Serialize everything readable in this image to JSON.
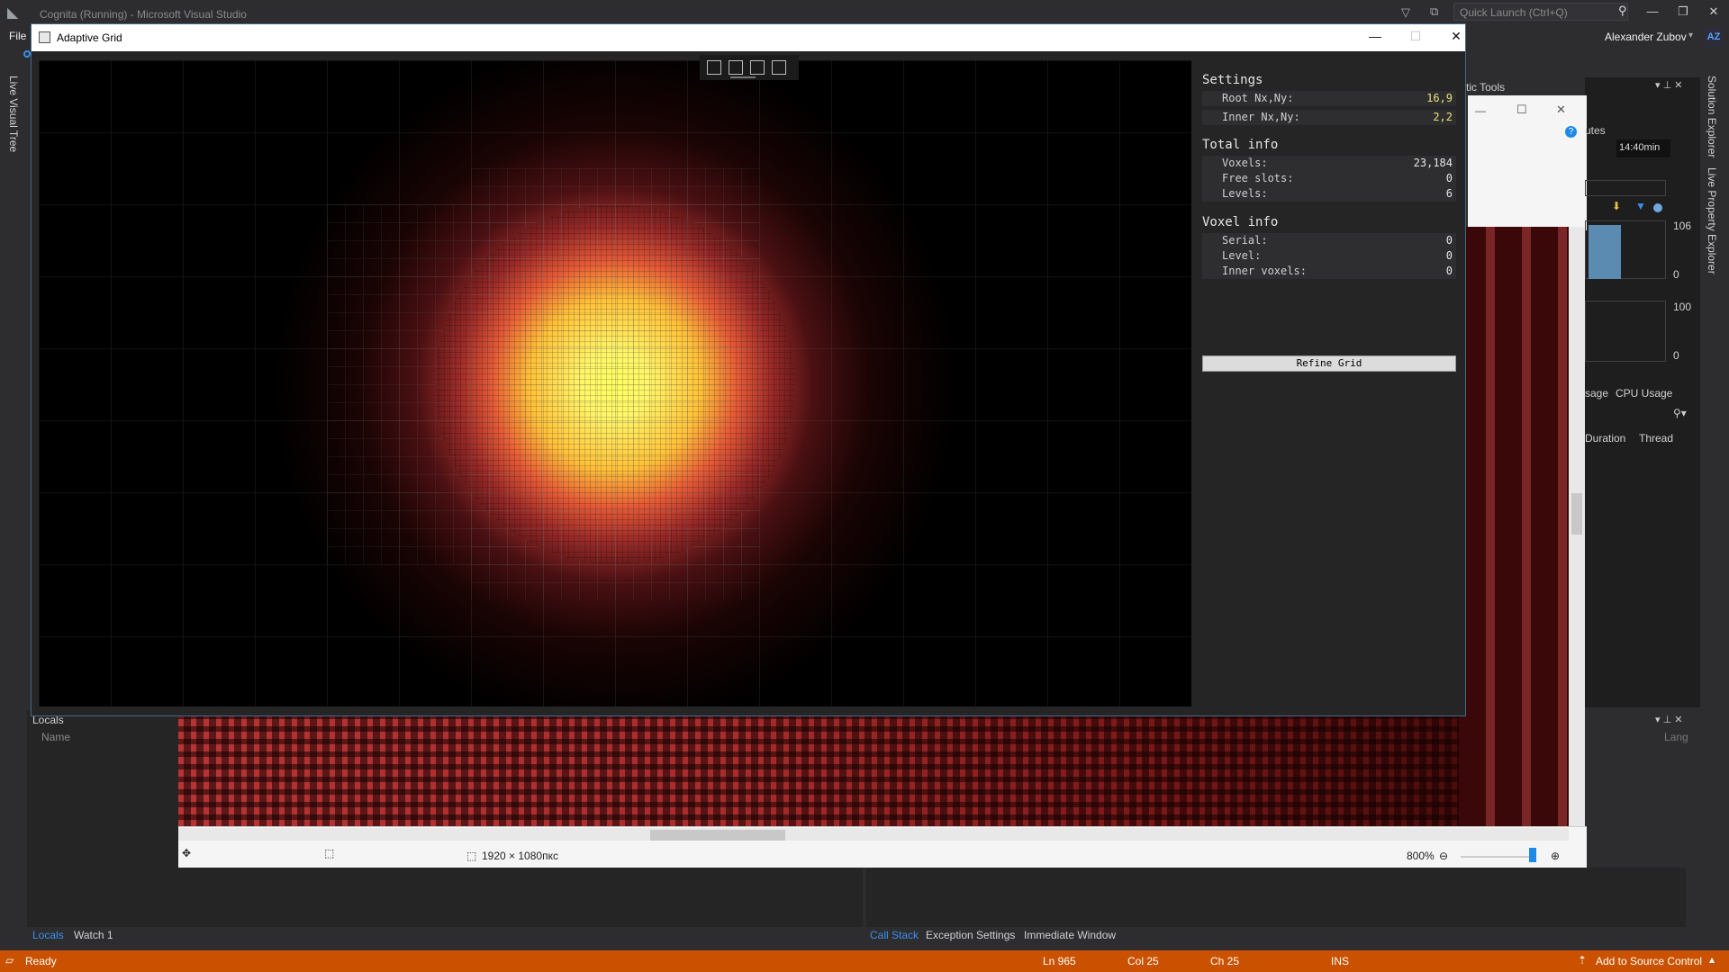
{
  "vs": {
    "title": "Cognita (Running) - Microsoft Visual Studio",
    "quick_launch_placeholder": "Quick Launch (Ctrl+Q)",
    "menu_file": "File",
    "user_name": "Alexander Zubov",
    "user_initials": "AZ",
    "left_vertical_tab": "Live Visual Tree",
    "right_vertical_tab_1": "Solution Explorer",
    "right_vertical_tab_2": "Live Property Explorer"
  },
  "diagnostics": {
    "title": "tic Tools",
    "section": "utes",
    "time": "14:40min",
    "val_106": "106",
    "val_0a": "0",
    "val_100": "100",
    "val_0b": "0",
    "tab_usage": "sage",
    "tab_cpu": "CPU Usage",
    "col_duration": "Duration",
    "col_thread": "Thread",
    "lang": "Lang"
  },
  "pixel_viewer": {
    "dimensions": "1920 × 1080пкс",
    "zoom": "800%"
  },
  "locals": {
    "title": "Locals",
    "col_name": "Name"
  },
  "bottom_tabs": {
    "locals": "Locals",
    "watch1": "Watch 1",
    "call_stack": "Call Stack",
    "exception_settings": "Exception Settings",
    "immediate_window": "Immediate Window"
  },
  "status_bar": {
    "ready": "Ready",
    "ln": "Ln 965",
    "col": "Col 25",
    "ch": "Ch 25",
    "ins": "INS",
    "source_control": "Add to Source Control"
  },
  "adaptive_grid": {
    "window_title": "Adaptive Grid",
    "settings": {
      "title": "Settings",
      "rows": [
        {
          "key": "Root Nx,Ny:",
          "value": "16,9"
        },
        {
          "key": "Inner Nx,Ny:",
          "value": "2,2"
        }
      ]
    },
    "total_info": {
      "title": "Total info",
      "rows": [
        {
          "key": "Voxels:",
          "value": "23,184"
        },
        {
          "key": "Free slots:",
          "value": "0"
        },
        {
          "key": "Levels:",
          "value": "6"
        }
      ]
    },
    "voxel_info": {
      "title": "Voxel info",
      "rows": [
        {
          "key": "Serial:",
          "value": "0"
        },
        {
          "key": "Level:",
          "value": "0"
        },
        {
          "key": "Inner voxels:",
          "value": "0"
        }
      ]
    },
    "refine_button": "Refine Grid"
  }
}
